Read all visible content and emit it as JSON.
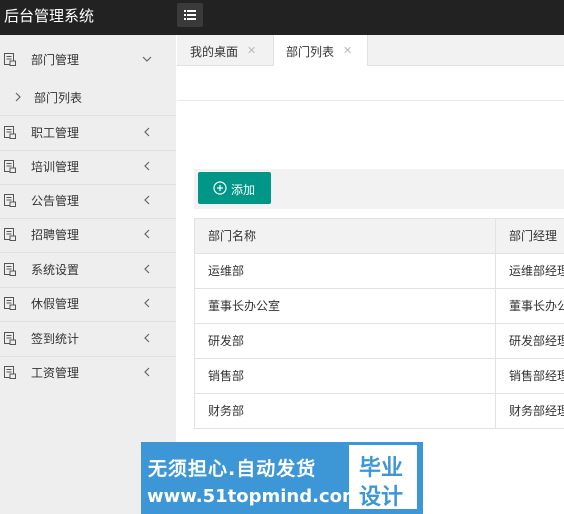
{
  "app": {
    "title": "后台管理系统"
  },
  "sidebar": {
    "items": [
      {
        "label": "部门管理",
        "icon": "document-icon",
        "expanded": true,
        "children": [
          {
            "label": "部门列表"
          }
        ]
      },
      {
        "label": "职工管理",
        "icon": "document-icon",
        "expanded": false
      },
      {
        "label": "培训管理",
        "icon": "document-icon",
        "expanded": false
      },
      {
        "label": "公告管理",
        "icon": "document-icon",
        "expanded": false
      },
      {
        "label": "招聘管理",
        "icon": "document-icon",
        "expanded": false
      },
      {
        "label": "系统设置",
        "icon": "document-icon",
        "expanded": false
      },
      {
        "label": "休假管理",
        "icon": "document-icon",
        "expanded": false
      },
      {
        "label": "签到统计",
        "icon": "document-icon",
        "expanded": false
      },
      {
        "label": "工资管理",
        "icon": "document-icon",
        "expanded": false
      }
    ]
  },
  "tabs": [
    {
      "label": "我的桌面",
      "active": false
    },
    {
      "label": "部门列表",
      "active": true
    }
  ],
  "toolbar": {
    "add_label": "添加"
  },
  "table": {
    "columns": [
      "部门名称",
      "部门经理"
    ],
    "rows": [
      [
        "运维部",
        "运维部经理"
      ],
      [
        "董事长办公室",
        "董事长办公"
      ],
      [
        "研发部",
        "研发部经理"
      ],
      [
        "销售部",
        "销售部经理"
      ],
      [
        "财务部",
        "财务部经理"
      ]
    ]
  },
  "banner": {
    "line1": "无须担心.自动发货",
    "line2": "www.51topmind.com",
    "box_line1": "毕业",
    "box_line2": "设计"
  },
  "colors": {
    "topbar": "#222222",
    "sidebar": "#eeeeee",
    "accent": "#009688",
    "banner": "#3d96d6"
  }
}
